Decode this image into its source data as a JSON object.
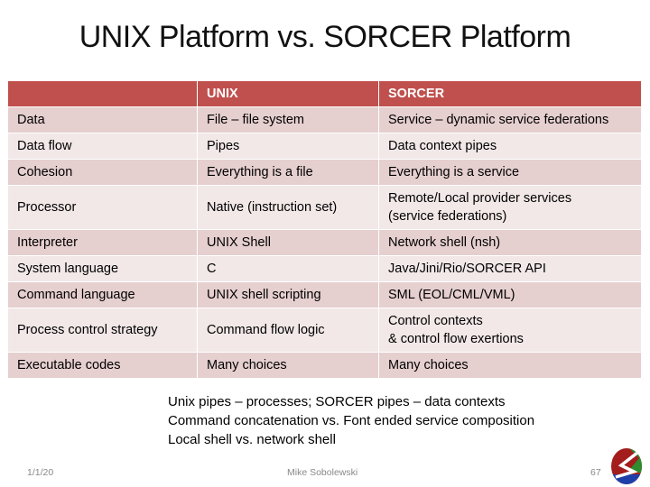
{
  "slide": {
    "title": "UNIX Platform vs. SORCER Platform",
    "table": {
      "headers": [
        "",
        "UNIX",
        "SORCER"
      ],
      "rows": [
        {
          "aspect": "Data",
          "unix": "File – file system",
          "sorcer": "Service – dynamic service federations"
        },
        {
          "aspect": "Data flow",
          "unix": "Pipes",
          "sorcer": "Data context pipes"
        },
        {
          "aspect": "Cohesion",
          "unix": "Everything is a file",
          "sorcer": "Everything is a service"
        },
        {
          "aspect": "Processor",
          "unix": "Native (instruction set)",
          "sorcer": "Remote/Local provider services",
          "sorcer_line2": "(service federations)"
        },
        {
          "aspect": "Interpreter",
          "unix": "UNIX Shell",
          "sorcer": "Network shell (nsh)"
        },
        {
          "aspect": "System language",
          "unix": "C",
          "sorcer": "Java/Jini/Rio/SORCER API"
        },
        {
          "aspect": "Command language",
          "unix": "UNIX shell scripting",
          "sorcer": "SML (EOL/CML/VML)"
        },
        {
          "aspect": "Process control strategy",
          "unix": "Command flow logic",
          "sorcer": "Control contexts",
          "sorcer_line2": "& control flow exertions"
        },
        {
          "aspect": "Executable codes",
          "unix": "Many choices",
          "sorcer": "Many choices"
        }
      ]
    },
    "notes": [
      "Unix pipes – processes; SORCER pipes – data contexts",
      "Command concatenation vs. Font ended service composition",
      "Local shell vs. network shell"
    ],
    "footer": {
      "date": "1/1/20",
      "author": "Mike Sobolewski",
      "page": "67",
      "logo_icon": "sorcer-logo-icon"
    },
    "colors": {
      "header_bg": "#c0504d",
      "row_odd_bg": "#e6cfcf",
      "row_even_bg": "#f2e8e8"
    }
  }
}
